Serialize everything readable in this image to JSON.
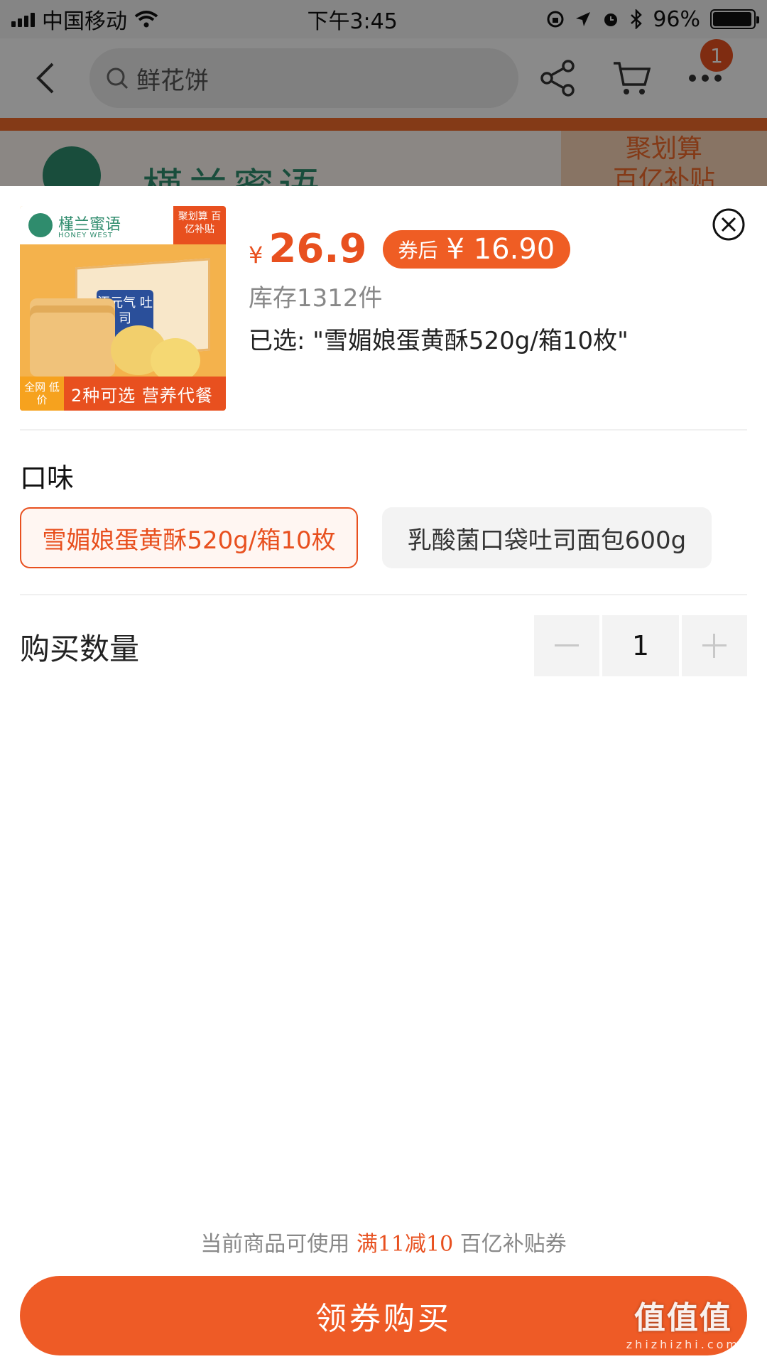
{
  "status_bar": {
    "carrier": "中国移动",
    "time": "下午3:45",
    "battery": "96%"
  },
  "nav": {
    "search_value": "鲜花饼",
    "cart_badge": "1"
  },
  "banner": {
    "brand": "槿兰蜜语",
    "tag_line1": "聚划算",
    "tag_line2": "百亿补贴"
  },
  "product": {
    "thumb": {
      "brand": "槿兰蜜语",
      "brand_en": "HONEY WEST",
      "tag": "聚划算 百亿补贴",
      "box_label": "添元气 吐司",
      "badge": "全网 低价",
      "bottom_text": "2种可选 营养代餐"
    },
    "price_symbol": "¥",
    "price": "26.9",
    "coupon_label": "券后",
    "coupon_price": "¥ 16.90",
    "stock": "库存1312件",
    "selected": "已选: \"雪媚娘蛋黄酥520g/箱10枚\""
  },
  "flavor": {
    "title": "口味",
    "options": [
      {
        "label": "雪媚娘蛋黄酥520g/箱10枚",
        "selected": true
      },
      {
        "label": "乳酸菌口袋吐司面包600g",
        "selected": false
      }
    ]
  },
  "quantity": {
    "label": "购买数量",
    "value": "1"
  },
  "footer": {
    "note_prefix": "当前商品可使用",
    "note_highlight": "满11减10",
    "note_suffix": "百亿补贴券",
    "buy_label": "领券购买"
  },
  "watermark": {
    "main": "值值值",
    "sub": "zhizhizhi.com"
  },
  "colors": {
    "accent": "#e8501f",
    "button": "#ee5b26"
  }
}
